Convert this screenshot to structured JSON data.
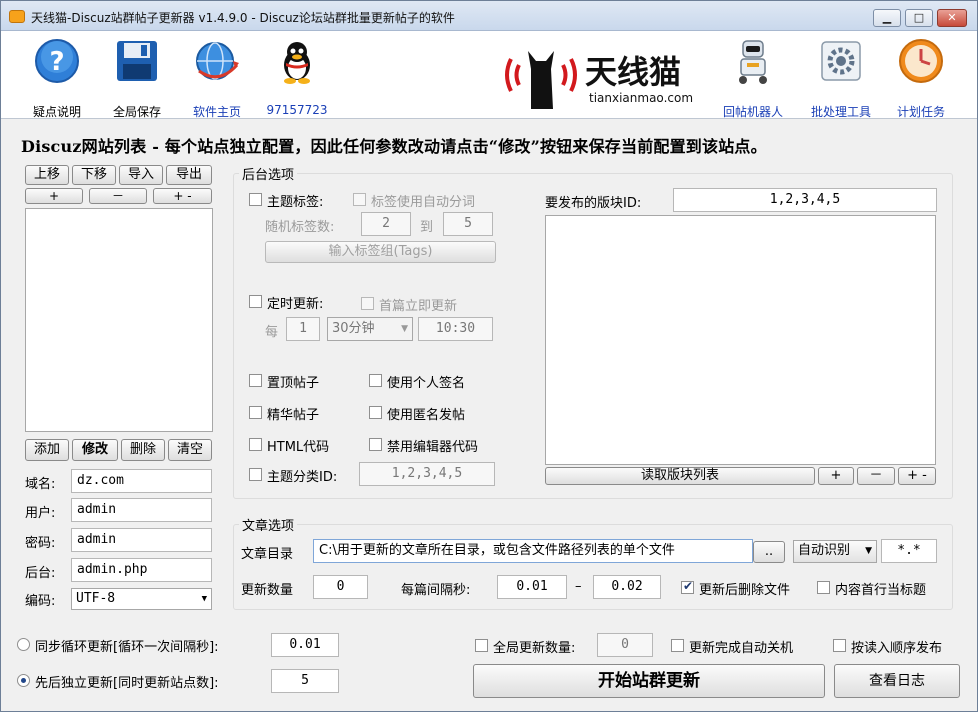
{
  "window": {
    "title": "天线猫-Discuz站群帖子更新器 v1.4.9.0 - Discuz论坛站群批量更新帖子的软件",
    "minimize": "▁",
    "maximize": "□",
    "close": "✕"
  },
  "toolbar": {
    "help": "疑点说明",
    "save_all": "全局保存",
    "homepage": "软件主页",
    "qq": "97157723",
    "logo_brand": "天线猫",
    "logo_url": "tianxianmao.com",
    "reply_robot": "回帖机器人",
    "batch_tool": "批处理工具",
    "schedule": "计划任务"
  },
  "heading": "Discuz网站列表 - 每个站点独立配置，因此任何参数改动请点击“修改”按钮来保存当前配置到该站点。",
  "site_list": {
    "move_up": "上移",
    "move_down": "下移",
    "import": "导入",
    "export": "导出",
    "plus": "+",
    "minus": "－",
    "plus_minus": "+ -",
    "add": "添加",
    "modify": "修改",
    "delete": "删除",
    "clear": "清空"
  },
  "site_form": {
    "domain_label": "域名:",
    "domain_value": "dz.com",
    "user_label": "用户:",
    "user_value": "admin",
    "password_label": "密码:",
    "password_value": "admin",
    "backend_label": "后台:",
    "backend_value": "admin.php",
    "encoding_label": "编码:",
    "encoding_value": "UTF-8"
  },
  "backend": {
    "title": "后台选项",
    "topic_tags": "主题标签:",
    "auto_tag_segment": "标签使用自动分词",
    "random_tag_count": "随机标签数:",
    "tag_min": "2",
    "tag_to": "到",
    "tag_max": "5",
    "input_tags_button": "输入标签组(Tags)",
    "timed_update": "定时更新:",
    "first_immediate": "首篇立即更新",
    "every": "每",
    "every_value": "1",
    "interval_unit": "30分钟",
    "time_value": "10:30",
    "sticky": "置顶帖子",
    "personal_signature": "使用个人签名",
    "digest": "精华帖子",
    "anonymous": "使用匿名发帖",
    "html_code": "HTML代码",
    "disable_editor_code": "禁用编辑器代码",
    "topic_category_id": "主题分类ID:",
    "topic_category_value": "1,2,3,4,5",
    "forum_id_label": "要发布的版块ID:",
    "forum_id_value": "1,2,3,4,5",
    "read_forum_list": "读取版块列表",
    "plus": "+",
    "minus": "－",
    "plus_minus": "+ -"
  },
  "article": {
    "title": "文章选项",
    "dir_label": "文章目录",
    "dir_value": "C:\\用于更新的文章所在目录，或包含文件路径列表的单个文件",
    "browse": "..",
    "encoding_detect": "自动识别",
    "ext_value": "*.*",
    "update_count_label": "更新数量",
    "update_count_value": "0",
    "interval_label": "每篇间隔秒:",
    "interval_min": "0.01",
    "interval_dash": "–",
    "interval_max": "0.02",
    "delete_after": "更新后删除文件",
    "first_line_title": "内容首行当标题"
  },
  "bottom": {
    "sync_loop": "同步循环更新[循环一次间隔秒]:",
    "sync_loop_value": "0.01",
    "independent": "先后独立更新[同时更新站点数]:",
    "independent_value": "5",
    "global_count": "全局更新数量:",
    "global_count_value": "0",
    "auto_shutdown": "更新完成自动关机",
    "order_publish": "按读入顺序发布",
    "start_button": "开始站群更新",
    "view_log": "查看日志"
  }
}
